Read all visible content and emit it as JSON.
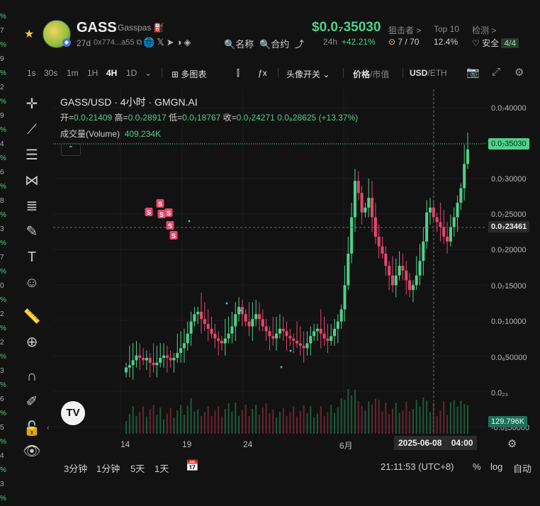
{
  "left_cut_column": [
    "%",
    "7",
    "%",
    "9",
    "%",
    "2",
    "%",
    "9",
    "%",
    "4",
    "%",
    "6",
    "%",
    "8",
    "%",
    "3",
    "%",
    "7",
    "%",
    "0",
    "%",
    "2",
    "%",
    "2",
    "%",
    "3",
    "%",
    "6",
    "%",
    "5",
    "%",
    "4",
    "%",
    "3",
    "%"
  ],
  "header": {
    "token_name": "GASS",
    "token_sub": "Gasspas",
    "age": "27d",
    "address": "0x774...a55",
    "links": {
      "name": "名称",
      "contract": "合约"
    },
    "price": "$0.0₇35030",
    "change_label": "24h",
    "change_value": "+42.21%",
    "snipers": {
      "label": "狙击者 >",
      "value": "7 / 70"
    },
    "top10": {
      "label": "Top 10",
      "value": "12.4%"
    },
    "check": {
      "label": "检测 >",
      "value": "安全",
      "badge": "4/4"
    }
  },
  "toolbar": {
    "intervals": [
      "1s",
      "30s",
      "1m",
      "1H",
      "4H",
      "1D"
    ],
    "active_interval": "4H",
    "multi_chart": "多图表",
    "fx": "ƒx",
    "head_toggle": "头像开关",
    "price_label": "价格",
    "mcap_label": "市值",
    "usd": "USD",
    "eth": "ETH"
  },
  "legend": {
    "title": "GASS/USD · 4小时 · GMGN.AI",
    "ohlc": {
      "open_label": "开=",
      "open": "0.0₇21409",
      "high_label": "高=",
      "high": "0.0₇28917",
      "low_label": "低=",
      "low": "0.0₇18767",
      "close_label": "收=",
      "close": "0.0₇24271",
      "change": "0.0₈28625 (+13.37%)"
    },
    "volume_label": "成交量(Volume)",
    "volume_value": "409.234K"
  },
  "y_axis": {
    "ticks": [
      "0.0₇40000",
      "0.0₇35000",
      "0.0₇30000",
      "0.0₇25000",
      "0.0₇20000",
      "0.0₇15000",
      "0.0₇10000",
      "0.0₈50000",
      "0.0₂₃",
      "-0.0₈50000"
    ],
    "last_price_tag": "0.0₇35030",
    "crosshair_tag": "0.0₇23461",
    "volume_tag": "129.796K"
  },
  "x_axis": {
    "ticks": [
      "14",
      "19",
      "24",
      "6月"
    ],
    "crosshair_tag": "2025-06-08",
    "crosshair_time": "04:00"
  },
  "bottom": {
    "ranges": [
      "3分钟",
      "1分钟",
      "5天",
      "1天"
    ],
    "clock": "21:11:53 (UTC+8)",
    "pct": "%",
    "log": "log",
    "auto": "自动"
  },
  "colors": {
    "up": "#4fd18b",
    "down": "#e5466f",
    "sell_badge": "#e5466f",
    "background": "#121212"
  },
  "chart_data": {
    "type": "candlestick",
    "series_close": [
      0.08,
      0.09,
      0.11,
      0.13,
      0.12,
      0.11,
      0.12,
      0.1,
      0.09,
      0.1,
      0.12,
      0.13,
      0.12,
      0.11,
      0.12,
      0.14,
      0.16,
      0.18,
      0.22,
      0.27,
      0.3,
      0.31,
      0.28,
      0.26,
      0.24,
      0.22,
      0.2,
      0.19,
      0.18,
      0.2,
      0.22,
      0.25,
      0.3,
      0.33,
      0.3,
      0.27,
      0.25,
      0.28,
      0.3,
      0.28,
      0.25,
      0.23,
      0.21,
      0.2,
      0.22,
      0.24,
      0.23,
      0.21,
      0.2,
      0.19,
      0.18,
      0.17,
      0.16,
      0.18,
      0.21,
      0.23,
      0.24,
      0.22,
      0.2,
      0.19,
      0.21,
      0.24,
      0.27,
      0.32,
      0.42,
      0.55,
      0.7,
      0.85,
      0.8,
      0.72,
      0.74,
      0.78,
      0.7,
      0.62,
      0.58,
      0.55,
      0.5,
      0.46,
      0.42,
      0.46,
      0.5,
      0.48,
      0.44,
      0.4,
      0.42,
      0.46,
      0.52,
      0.6,
      0.72,
      0.74,
      0.7,
      0.68,
      0.66,
      0.62,
      0.6,
      0.66,
      0.7,
      0.76,
      0.82,
      0.92,
      0.98
    ],
    "ylim": [
      0,
      1
    ],
    "x_ticks": [
      "14",
      "19",
      "24",
      "6月"
    ]
  }
}
